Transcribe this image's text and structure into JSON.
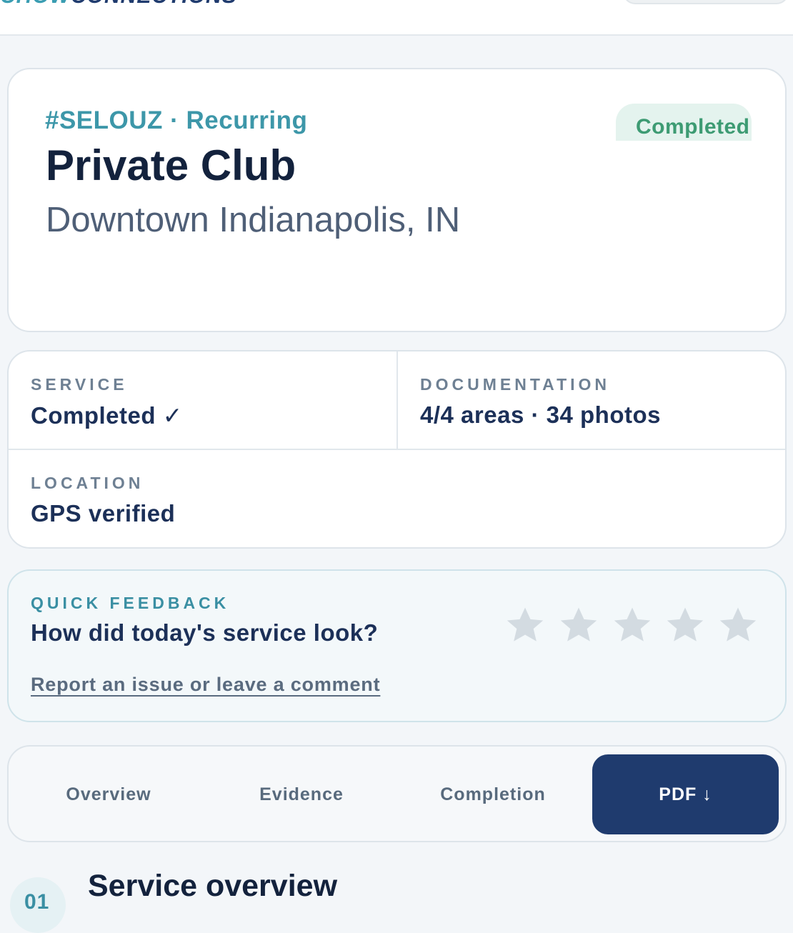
{
  "header": {
    "brand_part1": "CHOW",
    "brand_part2": "CONNECTIONS"
  },
  "job": {
    "reference": "#SELOUZ · Recurring",
    "title": "Private Club",
    "location": "Downtown Indianapolis, IN",
    "status": "Completed"
  },
  "stats": {
    "service_label": "SERVICE",
    "service_value": "Completed ✓",
    "documentation_label": "DOCUMENTATION",
    "documentation_value": "4/4 areas · 34 photos",
    "location_label": "LOCATION",
    "location_value": "GPS verified"
  },
  "feedback": {
    "label": "QUICK FEEDBACK",
    "question": "How did today's service look?",
    "link": "Report an issue or leave a comment",
    "rating": 0,
    "max_rating": 5
  },
  "tabs": [
    {
      "label": "Overview"
    },
    {
      "label": "Evidence"
    },
    {
      "label": "Completion"
    },
    {
      "label": "PDF ↓"
    }
  ],
  "section": {
    "number": "01",
    "title": "Service overview"
  },
  "colors": {
    "accent_teal": "#3d97a9",
    "primary_navy": "#1f3b6e",
    "status_green": "#3d9b73",
    "star_empty": "#d3dbe1"
  }
}
